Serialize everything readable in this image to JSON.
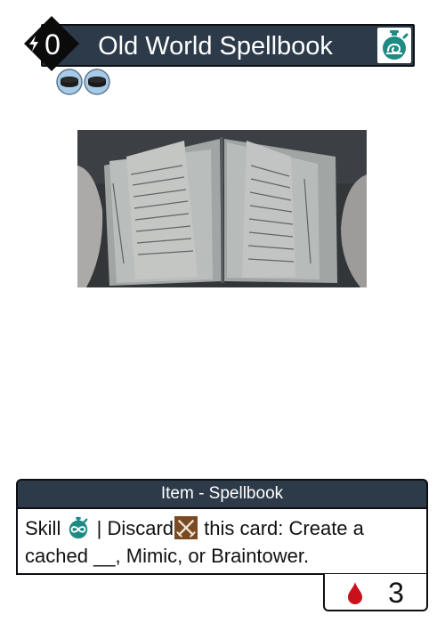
{
  "card": {
    "cost": "0",
    "name": "Old World Spellbook",
    "type_line": "Item - Spellbook",
    "rules": {
      "skill_word": "Skill",
      "separator": "|",
      "discard_word": "Discard",
      "effect_text": "this card: Create a cached __, Mimic, or Braintower."
    },
    "stat_value": "3"
  },
  "icons": {
    "cost": "lightning-bolt-icon",
    "title_badge": "slow-stopwatch-icon",
    "tokens": [
      "disc-token-icon",
      "disc-token-icon"
    ],
    "skill": "infinity-stopwatch-icon",
    "discard": "crossed-swords-icon",
    "stat": "blood-drop-icon"
  },
  "colors": {
    "title_bar": "#2d3a49",
    "teal_accent": "#1d8a84",
    "blood": "#c8111b",
    "discard_bg": "#7a4a22"
  },
  "art": {
    "alt": "Open old handwritten spellbook held in two hands"
  }
}
